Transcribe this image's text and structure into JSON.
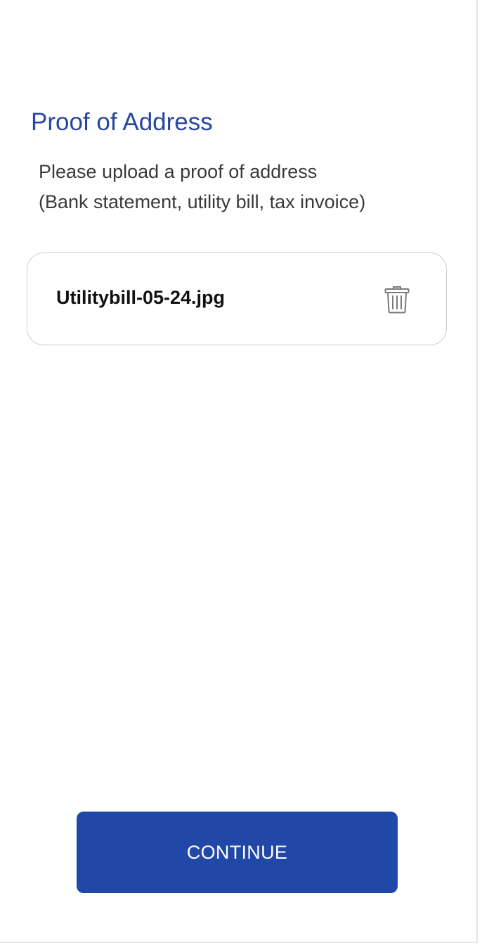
{
  "page": {
    "title": "Proof of Address",
    "instructions": {
      "line1": "Please upload a proof of address",
      "line2": "(Bank statement, utility bill, tax invoice)"
    }
  },
  "uploaded_file": {
    "name": "Utilitybill-05-24.jpg",
    "delete_icon": "trash-icon"
  },
  "actions": {
    "continue_label": "CONTINUE"
  },
  "colors": {
    "title": "#2746a0",
    "primary_button": "#2148a6",
    "card_border": "#cfcfcf"
  }
}
